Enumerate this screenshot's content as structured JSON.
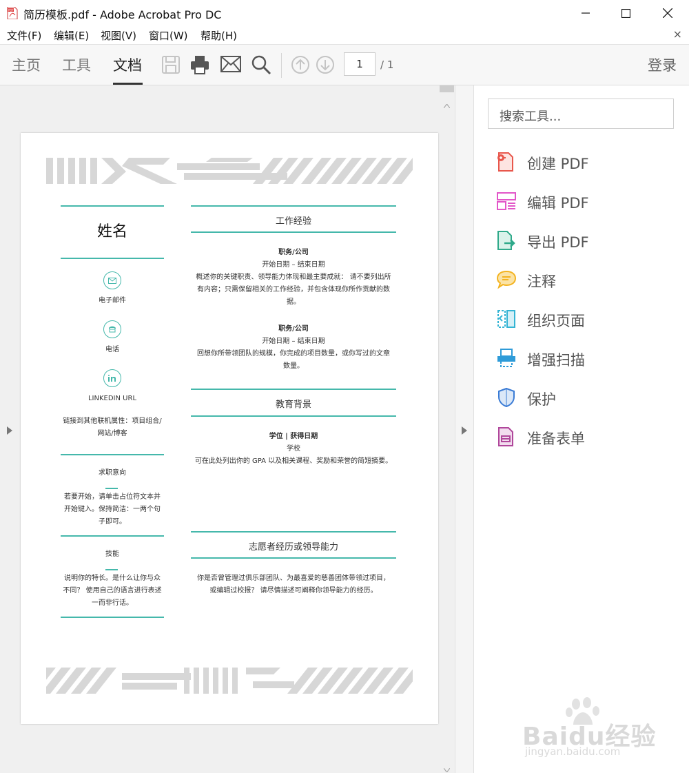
{
  "window": {
    "title": "简历模板.pdf - Adobe Acrobat Pro DC"
  },
  "menu": [
    "文件(F)",
    "编辑(E)",
    "视图(V)",
    "窗口(W)",
    "帮助(H)"
  ],
  "menu_close": "×",
  "toolbar": {
    "tabs": [
      "主页",
      "工具",
      "文档"
    ],
    "active_tab": "文档",
    "page_current": "1",
    "page_total": "/ 1",
    "login": "登录"
  },
  "resume": {
    "name": "姓名",
    "email_label": "电子邮件",
    "phone_label": "电话",
    "linkedin_label": "LINKEDIN URL",
    "link_note_line1": "链接到其他联机属性：项目组合/",
    "link_note_line2": "网站/博客",
    "objective_title": "求职意向",
    "objective_lines": [
      "若要开始，请单击占位符文本并",
      "开始键入。保持简洁：一两个句",
      "子即可。"
    ],
    "skills_title": "技能",
    "skills_lines": [
      "说明你的特长。是什么让你与众",
      "不同？ 使用自己的语言进行表述",
      "一而非行话。"
    ],
    "work_title": "工作经验",
    "job1": {
      "title": "职务/公司",
      "dates": "开始日期 – 结束日期",
      "desc": [
        "概述你的关键职责、领导能力体现和最主要成就： 请不要列出所",
        "有内容；只需保留相关的工作经验，并包含体现你所作贡献的数",
        "据。"
      ]
    },
    "job2": {
      "title": "职务/公司",
      "dates": "开始日期 – 结束日期",
      "desc": [
        "回想你所带领团队的规模，你完成的项目数量，或你写过的文章",
        "数量。"
      ]
    },
    "edu_title": "教育背景",
    "edu": {
      "degree": "学位 | 获得日期",
      "school": "学校",
      "desc": "可在此处列出你的 GPA 以及相关课程、奖励和荣誉的简短摘要。"
    },
    "vol_title": "志愿者经历或领导能力",
    "vol_desc": [
      "你是否曾管理过俱乐部团队、为最喜爱的慈善团体带领过项目，",
      "或编辑过校报？ 请尽情描述可阐释你领导能力的经历。"
    ]
  },
  "tools": {
    "search_placeholder": "搜索工具...",
    "items": [
      {
        "label": "创建 PDF",
        "icon": "create-pdf-icon",
        "color": "#e8574c"
      },
      {
        "label": "编辑 PDF",
        "icon": "edit-pdf-icon",
        "color": "#e256c8"
      },
      {
        "label": "导出 PDF",
        "icon": "export-pdf-icon",
        "color": "#2fa98a"
      },
      {
        "label": "注释",
        "icon": "comment-icon",
        "color": "#f3b320"
      },
      {
        "label": "组织页面",
        "icon": "organize-pages-icon",
        "color": "#33b4d4"
      },
      {
        "label": "增强扫描",
        "icon": "enhance-scan-icon",
        "color": "#2e9bd8"
      },
      {
        "label": "保护",
        "icon": "protect-icon",
        "color": "#3a7bd5"
      },
      {
        "label": "准备表单",
        "icon": "prepare-form-icon",
        "color": "#b0479b"
      }
    ]
  },
  "watermark": {
    "brand": "Baidu经验",
    "url": "jingyan.baidu.com"
  }
}
